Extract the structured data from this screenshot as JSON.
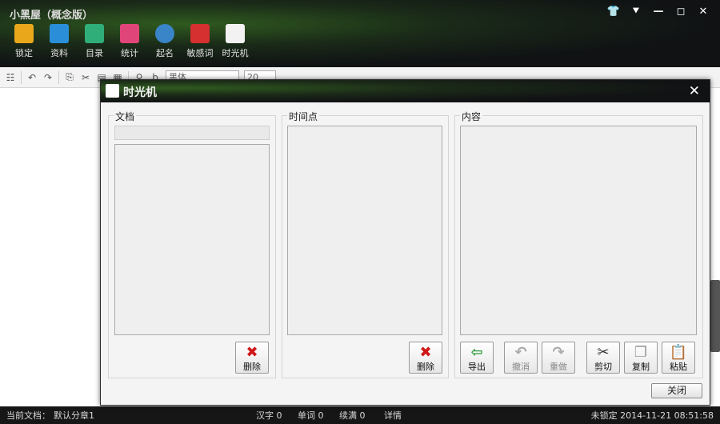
{
  "app": {
    "title": "小黑屋（概念版）"
  },
  "window_controls": [
    "👕",
    "⯆",
    "—",
    "◻",
    "✕"
  ],
  "ribbon": [
    {
      "label": "锁定",
      "icon": "lock-icon",
      "color": "#e9a81c"
    },
    {
      "label": "资料",
      "icon": "book-icon",
      "color": "#2a8fd8"
    },
    {
      "label": "目录",
      "icon": "list-icon",
      "color": "#2fae7a"
    },
    {
      "label": "统计",
      "icon": "chart-icon",
      "color": "#e0457a"
    },
    {
      "label": "起名",
      "icon": "person-icon",
      "color": "#3a84c8"
    },
    {
      "label": "敏感词",
      "icon": "chat-icon",
      "color": "#d63030"
    },
    {
      "label": "时光机",
      "icon": "timemachine-icon",
      "color": "#f2f2f2"
    }
  ],
  "toolbar": {
    "font": "黑体",
    "size": "20"
  },
  "status": {
    "doc_label": "当前文档：",
    "doc_value": "默认分章1",
    "words": "汉字 0",
    "words2": "单词 0",
    "continued": "续满 0",
    "detail": "详情",
    "lock_state": "未锁定 2014-11-21 08:51:58"
  },
  "dialog": {
    "title": "时光机",
    "docs_group": "文档",
    "time_group": "时间点",
    "content_group": "内容",
    "delete_label": "删除",
    "export_label": "导出",
    "undo_label": "撤消",
    "redo_label": "重做",
    "cut_label": "剪切",
    "copy_label": "复制",
    "paste_label": "粘贴",
    "close_label": "关闭"
  }
}
